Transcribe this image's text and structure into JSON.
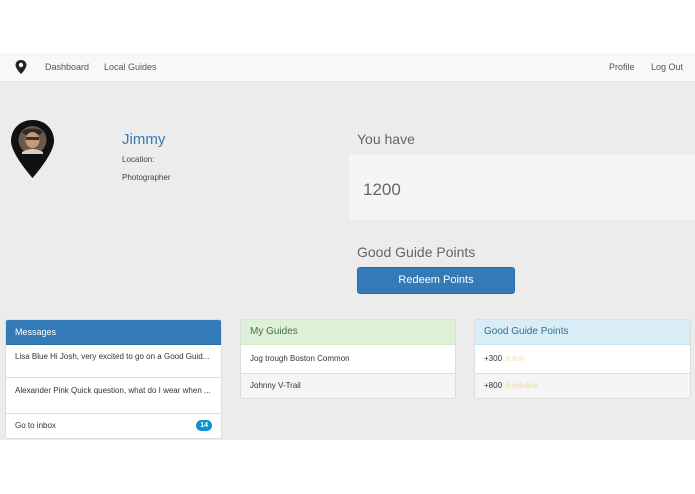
{
  "nav": {
    "logo_icon": "location-pin-icon",
    "links": [
      "Dashboard",
      "Local Guides"
    ],
    "right_links": [
      "Profile",
      "Log Out"
    ]
  },
  "profile": {
    "name": "Jimmy",
    "location_label": "Location:",
    "occupation": "Photographer"
  },
  "points": {
    "you_have_label": "You have",
    "value": "1200",
    "points_label": "Good Guide Points",
    "redeem_button": "Redeem Points"
  },
  "messages_panel": {
    "title": "Messages",
    "items": [
      "Lisa Blue Hi Josh, very excited to go on a Good Guid...",
      "Alexander Pink Quick question, what do I wear when ..."
    ],
    "inbox_label": "Go to inbox",
    "inbox_count": "14"
  },
  "guides_panel": {
    "title": "My Guides",
    "items": [
      "Jog trough Boston Common",
      "Johnny V-Trail"
    ]
  },
  "ggp_panel": {
    "title": "Good Guide Points",
    "items": [
      {
        "points": "+300",
        "stars": "☆☆☆",
        "star_count": 3
      },
      {
        "points": "+800",
        "stars": "☆☆☆☆☆",
        "star_count": 5
      }
    ]
  },
  "colors": {
    "primary": "#337ab7",
    "success_bg": "#dff0d8",
    "success_text": "#3c763d",
    "info_bg": "#d9edf7",
    "info_text": "#31708f",
    "badge": "#0e90d2",
    "star": "#e8b32a"
  }
}
